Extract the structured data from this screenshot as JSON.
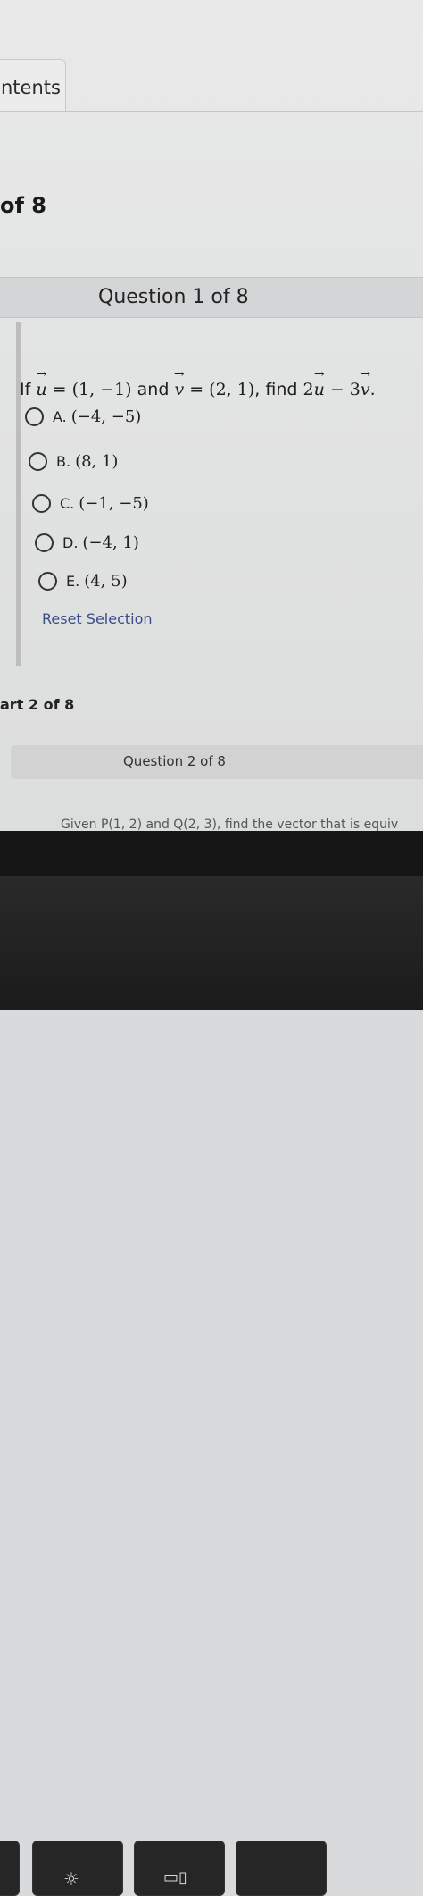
{
  "tab": {
    "label": "ntents"
  },
  "part": {
    "title": "of 8"
  },
  "question": {
    "header": "Question 1 of 8",
    "prefix": "If",
    "u_name": "u",
    "eq1": " = (1, −1)",
    "and_word": "and",
    "v_name": "v",
    "eq2": " = (2, 1)",
    "find_word": ", find",
    "expr_2": "2",
    "expr_minus3": " − 3",
    "expr_end": "."
  },
  "options": [
    {
      "letter": "A.",
      "value": "(−4, −5)"
    },
    {
      "letter": "B.",
      "value": "(8, 1)"
    },
    {
      "letter": "C.",
      "value": "(−1, −5)"
    },
    {
      "letter": "D.",
      "value": "(−4, 1)"
    },
    {
      "letter": "E.",
      "value": "(4, 5)"
    }
  ],
  "reset_label": "Reset Selection",
  "part2": {
    "title": "art 2 of 8",
    "header": "Question 2 of 8",
    "preview": "Given P(1, 2) and Q(2, 3), find the vector that is equiv"
  },
  "colors": {
    "link": "#3a4c8a",
    "bar": "#d4d5d6",
    "bezel": "#161616"
  },
  "keyboard_icons": [
    "brightness-icon",
    "window-icon"
  ]
}
